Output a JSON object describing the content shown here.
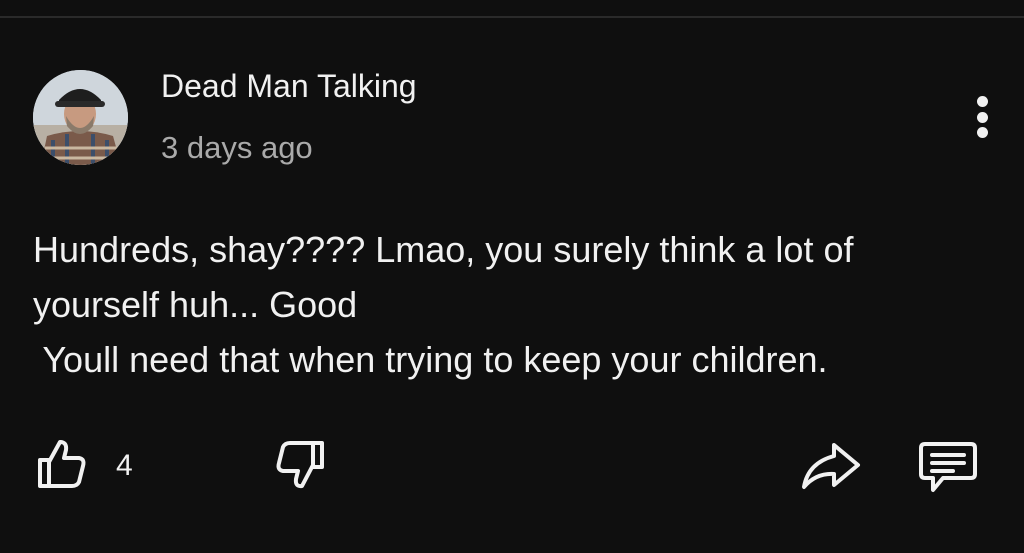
{
  "comment": {
    "author": "Dead Man Talking",
    "timestamp": "3 days ago",
    "body_lines": [
      "Hundreds, shay???? Lmao, you surely think a lot of",
      "yourself huh... Good",
      " Youll need that when trying to keep your children."
    ],
    "like_count": "4"
  },
  "icons": {
    "menu": "more-vert-icon",
    "like": "thumb-up-icon",
    "dislike": "thumb-down-icon",
    "share": "share-icon",
    "reply": "comment-icon"
  },
  "colors": {
    "background": "#0f0f0f",
    "primary_text": "#f1f1f1",
    "secondary_text": "#aaaaaa"
  }
}
